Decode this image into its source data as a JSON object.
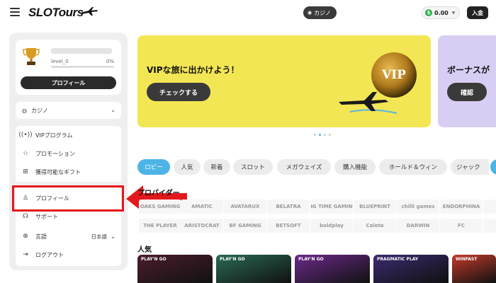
{
  "header": {
    "logo_text": "SLOTours",
    "mode_label": "カジノ",
    "balance": "0.00",
    "coin_symbol": "$",
    "deposit_label": "入金"
  },
  "profile": {
    "level": "level_0",
    "progress_label": "0%",
    "progress_fraction": 0,
    "button_label": "プロフィール"
  },
  "sidebar": {
    "casino_label": "カジノ",
    "menu": [
      {
        "label": "VIPプログラム",
        "icon": "vip-wave-icon"
      },
      {
        "label": "プロモーション",
        "icon": "promotion-icon"
      },
      {
        "label": "獲得可能なギフト",
        "icon": "gift-icon"
      },
      {
        "label": "プロフィール",
        "icon": "user-icon"
      },
      {
        "label": "サポート",
        "icon": "support-icon"
      },
      {
        "label": "言語",
        "icon": "globe-icon",
        "value": "日本語"
      },
      {
        "label": "ログアウト",
        "icon": "logout-icon"
      }
    ]
  },
  "banners": [
    {
      "title": "VIPな旅に出かけよう！",
      "button": "チェックする",
      "badge": "VIP",
      "color": "#f3e654"
    },
    {
      "title": "ボーナスが",
      "button": "確認",
      "color": "#d8cdf3"
    }
  ],
  "carousel": {
    "dot_count": 4,
    "active_index": 1
  },
  "categories": [
    "ロビー",
    "人気",
    "新着",
    "スロット",
    "メガウェイズ",
    "購入機能",
    "ホールド＆ウィン",
    "ジャック"
  ],
  "providers_title": "プロバイダー",
  "providers_row1": [
    "OAKS GAMING",
    "AMATIC",
    "AVATARUX",
    "BELATRA",
    "BIG TIME GAMING",
    "BLUEPRINT",
    "chilli games",
    "ENDORPHINA"
  ],
  "providers_row2": [
    "THE PLAYER",
    "ARISTOCRAT",
    "BF GAMING",
    "BETSOFT",
    "boldplay",
    "Caleta",
    "DARWIN",
    "FC"
  ],
  "popular_title": "人気",
  "games": [
    {
      "tag": "PLAY'N GO",
      "color": "#4a1d2c"
    },
    {
      "tag": "PLAY'N GO",
      "color": "#2a6a55"
    },
    {
      "tag": "PLAY'N GO",
      "color": "#6b2a8a"
    },
    {
      "tag": "PRAGMATIC PLAY",
      "color": "#3b2a6e"
    },
    {
      "tag": "WINFAST",
      "color": "#c33a2a"
    }
  ],
  "annotation": {
    "highlight_color": "#e4181c"
  }
}
